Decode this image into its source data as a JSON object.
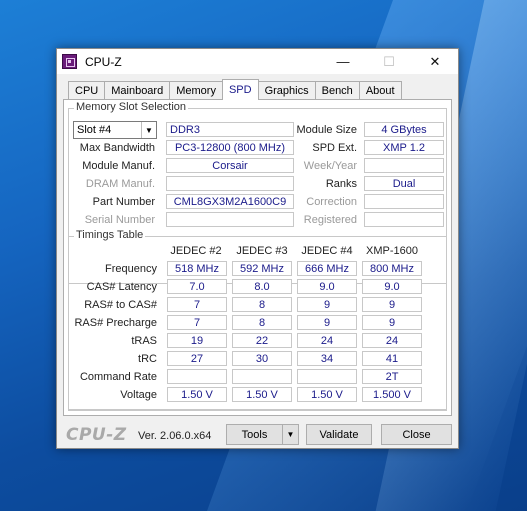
{
  "window": {
    "title": "CPU-Z",
    "minimize": "—",
    "maximize": "☐",
    "close": "✕"
  },
  "tabs": [
    {
      "label": "CPU"
    },
    {
      "label": "Mainboard"
    },
    {
      "label": "Memory"
    },
    {
      "label": "SPD"
    },
    {
      "label": "Graphics"
    },
    {
      "label": "Bench"
    },
    {
      "label": "About"
    }
  ],
  "active_tab": "SPD",
  "slot": {
    "group_title": "Memory Slot Selection",
    "selected": "Slot #4",
    "type": "DDR3",
    "max_bandwidth_label": "Max Bandwidth",
    "max_bandwidth": "PC3-12800 (800 MHz)",
    "module_manuf_label": "Module Manuf.",
    "module_manuf": "Corsair",
    "dram_manuf_label": "DRAM Manuf.",
    "dram_manuf": "",
    "part_number_label": "Part Number",
    "part_number": "CML8GX3M2A1600C9",
    "serial_number_label": "Serial Number",
    "serial_number": "",
    "module_size_label": "Module Size",
    "module_size": "4 GBytes",
    "spd_ext_label": "SPD Ext.",
    "spd_ext": "XMP 1.2",
    "week_year_label": "Week/Year",
    "week_year": "",
    "ranks_label": "Ranks",
    "ranks": "Dual",
    "correction_label": "Correction",
    "correction": "",
    "registered_label": "Registered",
    "registered": ""
  },
  "timings": {
    "group_title": "Timings Table",
    "columns": [
      "JEDEC #2",
      "JEDEC #3",
      "JEDEC #4",
      "XMP-1600"
    ],
    "rows": [
      {
        "label": "Frequency",
        "values": [
          "518 MHz",
          "592 MHz",
          "666 MHz",
          "800 MHz"
        ]
      },
      {
        "label": "CAS# Latency",
        "values": [
          "7.0",
          "8.0",
          "9.0",
          "9.0"
        ]
      },
      {
        "label": "RAS# to CAS#",
        "values": [
          "7",
          "8",
          "9",
          "9"
        ]
      },
      {
        "label": "RAS# Precharge",
        "values": [
          "7",
          "8",
          "9",
          "9"
        ]
      },
      {
        "label": "tRAS",
        "values": [
          "19",
          "22",
          "24",
          "24"
        ]
      },
      {
        "label": "tRC",
        "values": [
          "27",
          "30",
          "34",
          "41"
        ]
      },
      {
        "label": "Command Rate",
        "values": [
          "",
          "",
          "",
          "2T"
        ]
      },
      {
        "label": "Voltage",
        "values": [
          "1.50 V",
          "1.50 V",
          "1.50 V",
          "1.500 V"
        ]
      }
    ]
  },
  "footer": {
    "brand": "CPU-Z",
    "version": "Ver. 2.06.0.x64",
    "tools_label": "Tools",
    "validate_label": "Validate",
    "close_label": "Close"
  }
}
